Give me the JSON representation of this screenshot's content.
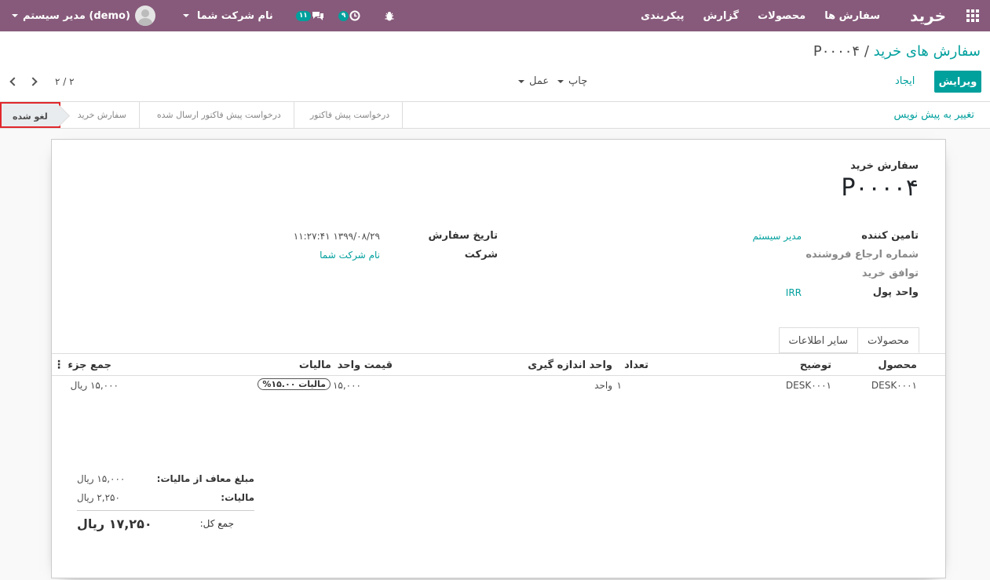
{
  "navbar": {
    "brand": "خرید",
    "menu": [
      "سفارش ها",
      "محصولات",
      "گزارش",
      "پیکربندی"
    ],
    "company": "نام شرکت شما",
    "user": "مدیر سیستم (demo)",
    "messages_count": "۱۱",
    "activities_count": "۹"
  },
  "breadcrumb": {
    "parent": "سفارش های خرید",
    "sep": "/",
    "current": "P۰۰۰۰۴"
  },
  "controls": {
    "edit": "ویرایش",
    "create": "ایجاد",
    "print": "چاپ",
    "action": "عمل",
    "pager": "۲ / ۲"
  },
  "status": {
    "draft_button": "تغییر به پیش نویس",
    "stages": [
      "درخواست پیش فاکتور",
      "درخواست پیش فاکتور ارسال شده",
      "سفارش خرید",
      "لغو شده"
    ],
    "active": "لغو شده"
  },
  "form": {
    "doc_label": "سفارش خرید",
    "doc_name": "P۰۰۰۰۴",
    "vendor_label": "تامین کننده",
    "vendor": "مدیر سیستم",
    "vendor_ref_label": "شماره ارجاع فروشنده",
    "agreement_label": "توافق خرید",
    "currency_label": "واحد پول",
    "currency": "IRR",
    "order_date_label": "تاریخ سفارش",
    "order_date": "۱۳۹۹/۰۸/۲۹ ۱۱:۲۷:۴۱",
    "company_label": "شرکت",
    "company": "نام شرکت شما"
  },
  "tabs": [
    "محصولات",
    "سایر اطلاعات"
  ],
  "lines": {
    "headers": {
      "product": "محصول",
      "description": "توضیح",
      "qty": "تعداد",
      "uom": "واحد اندازه گیری",
      "price": "قیمت واحد",
      "taxes": "مالیات",
      "subtotal": "جمع جزء"
    },
    "rows": [
      {
        "product": "DESK۰۰۰۱",
        "description": "DESK۰۰۰۱",
        "qty": "۱",
        "uom": "واحد",
        "price": "۱۵,۰۰۰",
        "taxes": "مالیات ۱۵.۰۰%",
        "subtotal": "۱۵,۰۰۰ ریال"
      }
    ]
  },
  "totals": {
    "untaxed_label": "مبلغ معاف از مالیات:",
    "untaxed": "۱۵,۰۰۰ ریال",
    "tax_label": "مالیات:",
    "tax": "۲,۲۵۰ ریال",
    "total_label": "جمع کل:",
    "total": "۱۷,۲۵۰ ریال"
  }
}
